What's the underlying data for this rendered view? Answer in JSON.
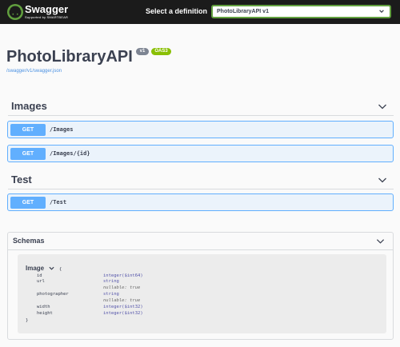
{
  "topbar": {
    "brand_name": "Swagger",
    "brand_subtitle": "Supported by SMARTBEAR",
    "definition_label": "Select a definition",
    "definition_selected": "PhotoLibraryAPI v1",
    "accent_color": "#62a03f"
  },
  "info": {
    "title": "PhotoLibraryAPI",
    "version_badge": "v1",
    "oas_badge": "OAS3",
    "spec_link": "/swagger/v1/swagger.json"
  },
  "tags": [
    {
      "name": "Images",
      "operations": [
        {
          "method": "GET",
          "path": "/Images"
        },
        {
          "method": "GET",
          "path": "/Images/{id}"
        }
      ]
    },
    {
      "name": "Test",
      "operations": [
        {
          "method": "GET",
          "path": "/Test"
        }
      ]
    }
  ],
  "schemas": {
    "title": "Schemas",
    "model": {
      "name": "Image",
      "open_brace": "{",
      "close_brace": "}",
      "properties": [
        {
          "name": "id",
          "type": "integer($int64)",
          "note": ""
        },
        {
          "name": "url",
          "type": "string",
          "note": "nullable: true"
        },
        {
          "name": "photographer",
          "type": "string",
          "note": "nullable: true"
        },
        {
          "name": "width",
          "type": "integer($int32)",
          "note": ""
        },
        {
          "name": "height",
          "type": "integer($int32)",
          "note": ""
        }
      ]
    }
  },
  "colors": {
    "get_method": "#61affe",
    "get_background": "#ebf3fb",
    "version_badge": "#7d8492",
    "oas_badge": "#89bf04",
    "link": "#4990e2"
  }
}
